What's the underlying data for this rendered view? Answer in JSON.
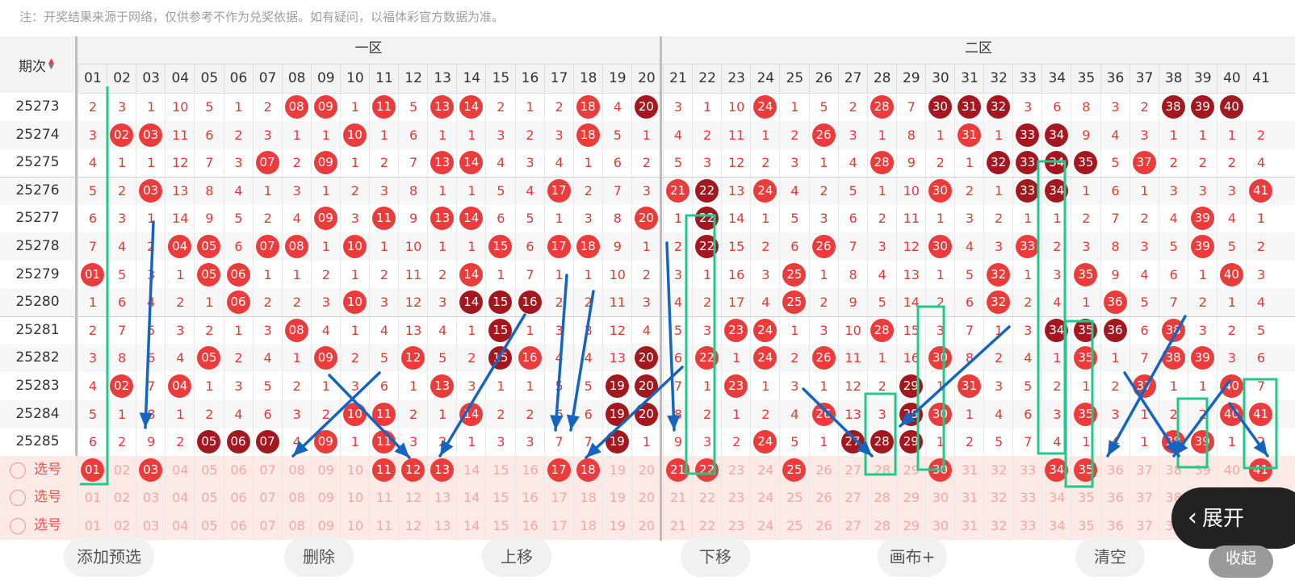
{
  "notice": "注：开奖结果来源于网络，仅供参考不作为兑奖依据。如有疑问，以福体彩官方数据为准。",
  "header": {
    "period_label": "期次",
    "zone1_label": "一区",
    "zone2_label": "二区",
    "columns": [
      "01",
      "02",
      "03",
      "04",
      "05",
      "06",
      "07",
      "08",
      "09",
      "10",
      "11",
      "12",
      "13",
      "14",
      "15",
      "16",
      "17",
      "18",
      "19",
      "20",
      "21",
      "22",
      "23",
      "24",
      "25",
      "26",
      "27",
      "28",
      "29",
      "30",
      "31",
      "32",
      "33",
      "34",
      "35",
      "36",
      "37",
      "38",
      "39",
      "40",
      "41"
    ]
  },
  "draws": [
    {
      "issue": "25273",
      "cells": [
        "2",
        "3",
        "1",
        "10",
        "5",
        "1",
        "2",
        "08*",
        "09*",
        "1",
        "11*",
        "5",
        "13*",
        "14*",
        "2",
        "1",
        "2",
        "18*",
        "4",
        "20!",
        "3",
        "1",
        "10",
        "24*",
        "1",
        "5",
        "2",
        "28*",
        "7",
        "30!",
        "31!",
        "32!",
        "3",
        "6",
        "8",
        "3",
        "2",
        "38!",
        "39!",
        "40!",
        ""
      ]
    },
    {
      "issue": "25274",
      "cells": [
        "3",
        "02*",
        "03*",
        "11",
        "6",
        "2",
        "3",
        "1",
        "1",
        "10*",
        "1",
        "6",
        "1",
        "1",
        "3",
        "2",
        "3",
        "18*",
        "5",
        "1",
        "4",
        "2",
        "11",
        "1",
        "2",
        "26*",
        "3",
        "1",
        "8",
        "1",
        "31*",
        "1",
        "33!",
        "34!",
        "9",
        "4",
        "3",
        "1",
        "1",
        "1",
        "2"
      ]
    },
    {
      "issue": "25275",
      "cells": [
        "4",
        "1",
        "1",
        "12",
        "7",
        "3",
        "07*",
        "2",
        "09*",
        "1",
        "2",
        "7",
        "13*",
        "14*",
        "4",
        "3",
        "4",
        "1",
        "6",
        "2",
        "5",
        "3",
        "12",
        "2",
        "3",
        "1",
        "4",
        "28*",
        "9",
        "2",
        "1",
        "32!",
        "33!",
        "34!",
        "35!",
        "5",
        "37*",
        "2",
        "2",
        "2",
        "4"
      ]
    },
    {
      "issue": "25276",
      "cells": [
        "5",
        "2",
        "03*",
        "13",
        "8",
        "4",
        "1",
        "3",
        "1",
        "2",
        "3",
        "8",
        "1",
        "1",
        "5",
        "4",
        "17*",
        "2",
        "7",
        "3",
        "21*",
        "22!",
        "13",
        "24*",
        "4",
        "2",
        "5",
        "1",
        "10",
        "30*",
        "2",
        "1",
        "33!",
        "34!",
        "1",
        "6",
        "1",
        "3",
        "3",
        "3",
        "41*"
      ]
    },
    {
      "issue": "25277",
      "cells": [
        "6",
        "3",
        "1",
        "14",
        "9",
        "5",
        "2",
        "4",
        "09*",
        "3",
        "11*",
        "9",
        "13*",
        "14*",
        "6",
        "5",
        "1",
        "3",
        "8",
        "20*",
        "1",
        "22!",
        "14",
        "1",
        "5",
        "3",
        "6",
        "2",
        "11",
        "1",
        "3",
        "2",
        "1",
        "1",
        "2",
        "7",
        "2",
        "4",
        "39*",
        "4",
        "1"
      ]
    },
    {
      "issue": "25278",
      "cells": [
        "7",
        "4",
        "2",
        "04*",
        "05*",
        "6",
        "07*",
        "08*",
        "1",
        "10*",
        "1",
        "10",
        "1",
        "1",
        "15*",
        "6",
        "17*",
        "18*",
        "9",
        "1",
        "2",
        "22!",
        "15",
        "2",
        "6",
        "26*",
        "7",
        "3",
        "12",
        "30*",
        "4",
        "3",
        "33*",
        "2",
        "3",
        "8",
        "3",
        "5",
        "39*",
        "5",
        "2"
      ]
    },
    {
      "issue": "25279",
      "cells": [
        "01*",
        "5",
        "3",
        "1",
        "05*",
        "06*",
        "1",
        "1",
        "2",
        "1",
        "2",
        "11",
        "2",
        "14*",
        "1",
        "7",
        "1",
        "1",
        "10",
        "2",
        "3",
        "1",
        "16",
        "3",
        "25*",
        "1",
        "8",
        "4",
        "13",
        "1",
        "5",
        "32*",
        "1",
        "3",
        "35*",
        "9",
        "4",
        "6",
        "1",
        "40*",
        "3"
      ]
    },
    {
      "issue": "25280",
      "cells": [
        "1",
        "6",
        "4",
        "2",
        "1",
        "06*",
        "2",
        "2",
        "3",
        "10*",
        "3",
        "12",
        "3",
        "14!",
        "15!",
        "16!",
        "2",
        "2",
        "11",
        "3",
        "4",
        "2",
        "17",
        "4",
        "25*",
        "2",
        "9",
        "5",
        "14",
        "2",
        "6",
        "32*",
        "2",
        "4",
        "1",
        "36*",
        "5",
        "7",
        "2",
        "1",
        "4"
      ]
    },
    {
      "issue": "25281",
      "cells": [
        "2",
        "7",
        "5",
        "3",
        "2",
        "1",
        "3",
        "08*",
        "4",
        "1",
        "4",
        "13",
        "4",
        "1",
        "15!",
        "1",
        "3",
        "3",
        "12",
        "4",
        "5",
        "3",
        "23*",
        "24*",
        "1",
        "3",
        "10",
        "28*",
        "15",
        "3",
        "7",
        "1",
        "3",
        "34!",
        "35!",
        "36!",
        "6",
        "38*",
        "3",
        "2",
        "5"
      ]
    },
    {
      "issue": "25282",
      "cells": [
        "3",
        "8",
        "6",
        "4",
        "05*",
        "2",
        "4",
        "1",
        "09*",
        "2",
        "5",
        "12*",
        "5",
        "2",
        "15!",
        "16*",
        "4",
        "4",
        "13",
        "20!",
        "6",
        "22*",
        "1",
        "24*",
        "2",
        "26*",
        "11",
        "1",
        "16",
        "30*",
        "8",
        "2",
        "4",
        "1",
        "35*",
        "1",
        "7",
        "38*",
        "39*",
        "3",
        "6"
      ]
    },
    {
      "issue": "25283",
      "cells": [
        "4",
        "02*",
        "7",
        "04*",
        "1",
        "3",
        "5",
        "2",
        "1",
        "3",
        "6",
        "1",
        "13*",
        "3",
        "1",
        "1",
        "5",
        "5",
        "19!",
        "20!",
        "7",
        "1",
        "23*",
        "1",
        "3",
        "1",
        "12",
        "2",
        "29!",
        "1",
        "31*",
        "3",
        "5",
        "2",
        "1",
        "2",
        "37*",
        "1",
        "1",
        "40*",
        "7"
      ]
    },
    {
      "issue": "25284",
      "cells": [
        "5",
        "1",
        "8",
        "1",
        "2",
        "4",
        "6",
        "3",
        "2",
        "10*",
        "11*",
        "2",
        "1",
        "14*",
        "2",
        "2",
        "6",
        "6",
        "19!",
        "20!",
        "8",
        "2",
        "1",
        "2",
        "4",
        "26*",
        "13",
        "3",
        "29!",
        "30*",
        "1",
        "4",
        "6",
        "3",
        "35*",
        "3",
        "1",
        "2",
        "2",
        "40*",
        "41*"
      ]
    },
    {
      "issue": "25285",
      "cells": [
        "6",
        "2",
        "9",
        "2",
        "05!",
        "06!",
        "07!",
        "4",
        "09*",
        "1",
        "11*",
        "3",
        "2",
        "1",
        "3",
        "3",
        "7",
        "7",
        "19!",
        "1",
        "9",
        "3",
        "2",
        "24*",
        "5",
        "1",
        "27!",
        "28!",
        "29!",
        "1",
        "2",
        "5",
        "7",
        "4",
        "1",
        "4",
        "1",
        "38*",
        "39*",
        "1",
        "2"
      ]
    }
  ],
  "selection_rows": [
    {
      "label": "选号",
      "balls": [
        "01",
        "03",
        "11",
        "12",
        "13",
        "17",
        "18",
        "21",
        "22",
        "25",
        "30",
        "34",
        "35",
        "41"
      ]
    },
    {
      "label": "选号",
      "balls": []
    },
    {
      "label": "选号",
      "balls": []
    }
  ],
  "actions": {
    "add_preset": "添加预选",
    "delete": "删除",
    "move_up": "上移",
    "move_down": "下移",
    "canvas": "画布+",
    "clear": "清空",
    "expand": "展开",
    "collapse": "收起"
  },
  "colors": {
    "ball_red": "#ec3b3b",
    "ball_dark": "#a3181f",
    "annotation_blue": "#1565c0",
    "annotation_green": "#1ec98a",
    "selected_row_bg": "#fde9e6"
  }
}
